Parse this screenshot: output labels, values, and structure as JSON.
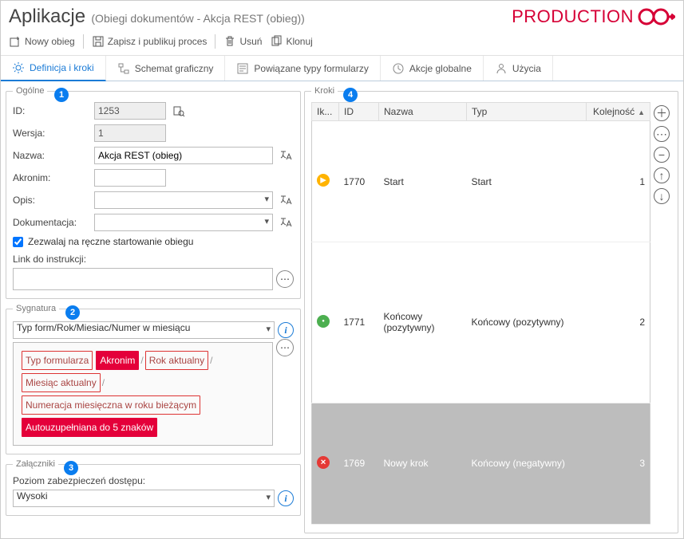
{
  "header": {
    "title": "Aplikacje",
    "subtitle": "(Obiegi dokumentów - Akcja REST (obieg))",
    "env": "PRODUCTION"
  },
  "toolbar": {
    "newFlow": "Nowy obieg",
    "saveAndPublish": "Zapisz i publikuj proces",
    "delete": "Usuń",
    "clone": "Klonuj"
  },
  "tabs": [
    {
      "label": "Definicja i kroki"
    },
    {
      "label": "Schemat graficzny"
    },
    {
      "label": "Powiązane typy formularzy"
    },
    {
      "label": "Akcje globalne"
    },
    {
      "label": "Użycia"
    }
  ],
  "general": {
    "legend": "Ogólne",
    "idLabel": "ID:",
    "idValue": "1253",
    "versionLabel": "Wersja:",
    "versionValue": "1",
    "nameLabel": "Nazwa:",
    "nameValue": "Akcja REST (obieg)",
    "acronymLabel": "Akronim:",
    "acronymValue": "",
    "descLabel": "Opis:",
    "descValue": "",
    "docLabel": "Dokumentacja:",
    "docValue": "",
    "allowManualLabel": "Zezwalaj na ręczne startowanie obiegu",
    "linkLabel": "Link do instrukcji:"
  },
  "signature": {
    "legend": "Sygnatura",
    "selectValue": "Typ form/Rok/Miesiac/Numer w miesiącu",
    "tags": {
      "t1": "Typ formularza",
      "t2": "Akronim",
      "t3": "Rok aktualny",
      "t4": "Miesiąc aktualny",
      "t5": "Numeracja miesięczna w roku bieżącym",
      "t6": "Autouzupełniana do 5 znaków"
    }
  },
  "attachments": {
    "legend": "Załączniki",
    "levelLabel": "Poziom zabezpieczeń dostępu:",
    "levelValue": "Wysoki"
  },
  "steps": {
    "legend": "Kroki",
    "cols": {
      "icon": "Ik...",
      "id": "ID",
      "name": "Nazwa",
      "type": "Typ",
      "order": "Kolejność"
    },
    "rows": [
      {
        "icon": "play",
        "id": "1770",
        "name": "Start",
        "type": "Start",
        "order": "1"
      },
      {
        "icon": "ok",
        "id": "1771",
        "name": "Końcowy (pozytywny)",
        "type": "Końcowy (pozytywny)",
        "order": "2"
      },
      {
        "icon": "err",
        "id": "1769",
        "name": "Nowy krok",
        "type": "Końcowy (negatywny)",
        "order": "3",
        "selected": true
      }
    ]
  }
}
